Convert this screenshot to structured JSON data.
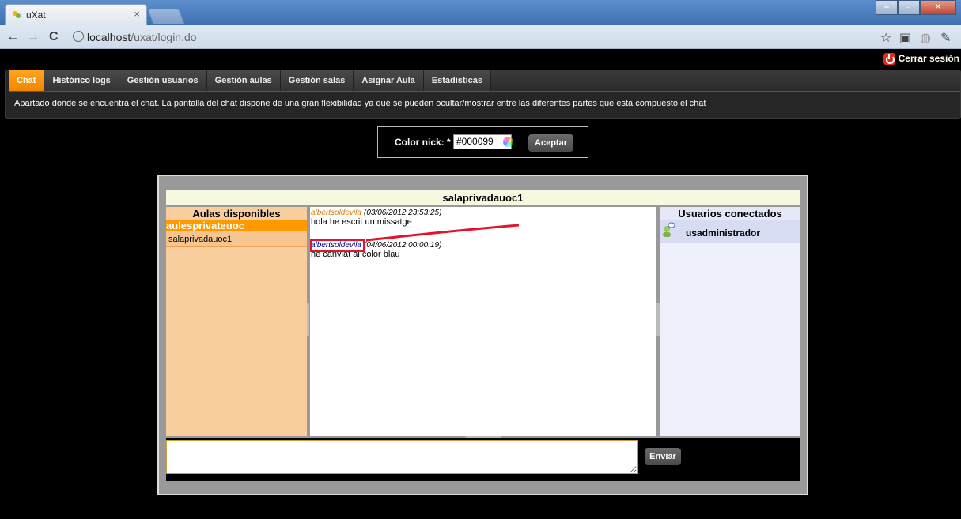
{
  "browser": {
    "tab_title": "uXat",
    "url_host": "localhost",
    "url_path": "/uxat/login.do",
    "colors": {
      "titlebar": "#4a7cbc",
      "toolbar": "#d6e1ee"
    }
  },
  "app": {
    "logout_label": "Cerrar sesión",
    "nav_tabs": [
      "Chat",
      "Histórico logs",
      "Gestión usuarios",
      "Gestión aulas",
      "Gestión salas",
      "Asignar Aula",
      "Estadísticas"
    ],
    "active_tab": "Chat",
    "nav_description": "Apartado donde se encuentra el chat. La pantalla del chat dispone de una gran flexibilidad ya que se pueden ocultar/mostrar entre las diferentes partes que está compuesto el chat",
    "accent": "#f39200"
  },
  "color_form": {
    "label": "Color nick: *",
    "value": "#000099",
    "accept_label": "Aceptar"
  },
  "chat": {
    "room_title": "salaprivadauoc1",
    "left_title": "Aulas disponibles",
    "group_name": "aulesprivateuoc",
    "rooms": [
      "salaprivadauoc1"
    ],
    "messages": [
      {
        "nick": "albertsoldevila",
        "time": "(03/06/2012 23:53:25)",
        "text": "hola he escrit un missatge",
        "nick_color": "#e07b00"
      },
      {
        "nick": "albertsoldevila",
        "time": "(04/06/2012 00:00:19)",
        "text": "he canviat al color blau",
        "nick_color": "#000099"
      }
    ],
    "right_title": "Usuarios conectados",
    "users": [
      "usadministrador"
    ],
    "send_label": "Enviar"
  }
}
